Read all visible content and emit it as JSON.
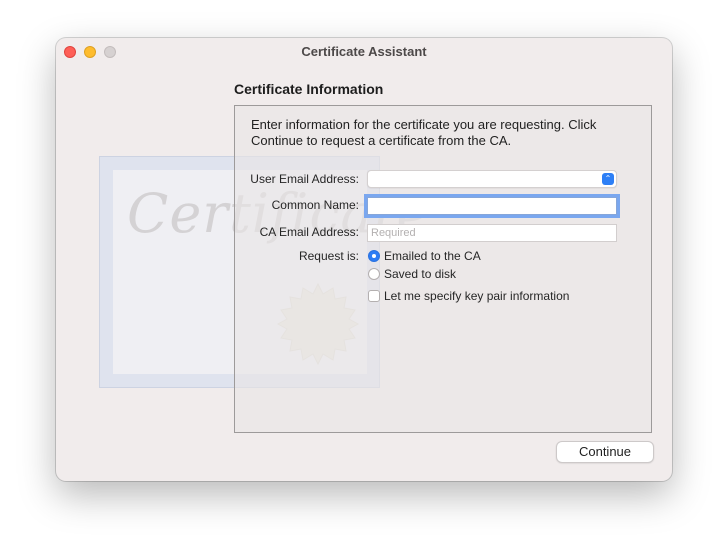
{
  "window": {
    "title": "Certificate Assistant"
  },
  "background_art": {
    "word": "Certificate"
  },
  "section": {
    "title": "Certificate Information"
  },
  "intro_text": "Enter information for the certificate you are requesting. Click Continue to request a certificate from the CA.",
  "form": {
    "user_email": {
      "label": "User Email Address:",
      "value": ""
    },
    "common_name": {
      "label": "Common Name:",
      "value": ""
    },
    "ca_email": {
      "label": "CA Email Address:",
      "placeholder": "Required",
      "value": ""
    },
    "request_is": {
      "label": "Request is:",
      "options": [
        {
          "label": "Emailed to the CA",
          "selected": true
        },
        {
          "label": "Saved to disk",
          "selected": false
        }
      ]
    },
    "key_pair": {
      "label": "Let me specify key pair information",
      "checked": false
    }
  },
  "buttons": {
    "continue": "Continue"
  },
  "colors": {
    "accent": "#2c7cf5",
    "close": "#fe5f57",
    "minimize": "#febc2e"
  }
}
